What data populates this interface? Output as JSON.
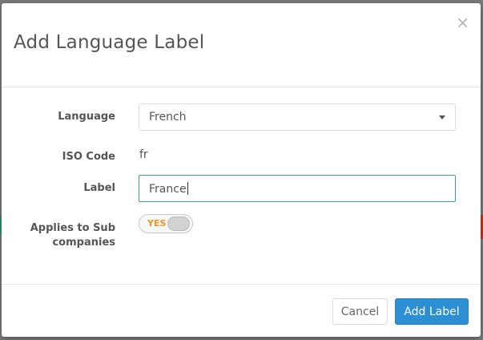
{
  "dialog": {
    "title": "Add Language Label",
    "close_symbol": "×"
  },
  "form": {
    "language": {
      "label": "Language",
      "value": "French"
    },
    "iso_code": {
      "label": "ISO Code",
      "value": "fr"
    },
    "label_field": {
      "label": "Label",
      "value": "France"
    },
    "applies_to_sub": {
      "label_line1": "Applies to Sub",
      "label_line2": "companies",
      "toggle_text": "YES",
      "checked": true
    }
  },
  "footer": {
    "cancel_label": "Cancel",
    "submit_label": "Add Label"
  },
  "colors": {
    "primary": "#2c8fd4",
    "focus_border": "#3aa38a",
    "toggle_text": "#f0932b"
  }
}
